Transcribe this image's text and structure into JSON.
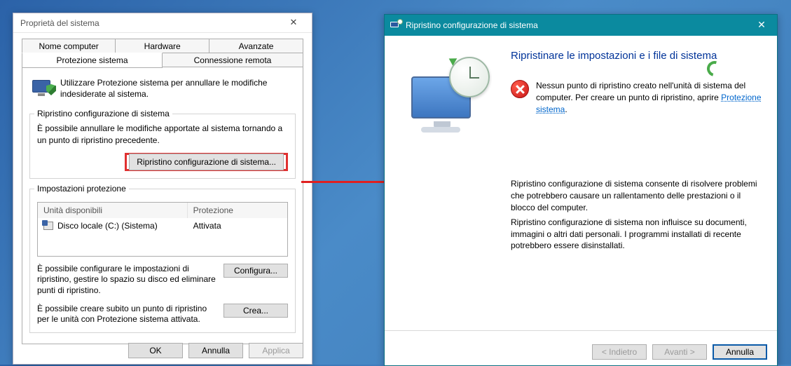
{
  "dlg1": {
    "title": "Proprietà del sistema",
    "tabs_top": [
      "Nome computer",
      "Hardware",
      "Avanzate"
    ],
    "tabs_bottom": [
      "Protezione sistema",
      "Connessione remota"
    ],
    "intro": "Utilizzare Protezione sistema per annullare le modifiche indesiderate al sistema.",
    "group_restore": {
      "legend": "Ripristino configurazione di sistema",
      "desc": "È possibile annullare le modifiche apportate al sistema tornando a un punto di ripristino precedente.",
      "button": "Ripristino configurazione di sistema..."
    },
    "group_settings": {
      "legend": "Impostazioni protezione",
      "col1": "Unità disponibili",
      "col2": "Protezione",
      "drive_name": "Disco locale (C:) (Sistema)",
      "drive_status": "Attivata",
      "cfg_text": "È possibile configurare le impostazioni di ripristino, gestire lo spazio su disco ed eliminare punti di ripristino.",
      "cfg_btn": "Configura...",
      "create_text": "È possibile creare subito un punto di ripristino per le unità con Protezione sistema attivata.",
      "create_btn": "Crea..."
    },
    "footer": {
      "ok": "OK",
      "cancel": "Annulla",
      "apply": "Applica"
    }
  },
  "dlg2": {
    "title": "Ripristino configurazione di sistema",
    "heading": "Ripristinare le impostazioni e i file di sistema",
    "warn_pre": "Nessun punto di ripristino creato nell'unità di sistema del computer. Per creare un punto di ripristino, aprire ",
    "warn_link": "Protezione sistema",
    "warn_post": ".",
    "info1": "Ripristino configurazione di sistema consente di risolvere problemi che potrebbero causare un rallentamento delle prestazioni o il blocco del computer.",
    "info2": "Ripristino configurazione di sistema non influisce su documenti, immagini o altri dati personali. I programmi installati di recente potrebbero essere disinstallati.",
    "footer": {
      "back": "< Indietro",
      "next": "Avanti >",
      "cancel": "Annulla"
    }
  }
}
